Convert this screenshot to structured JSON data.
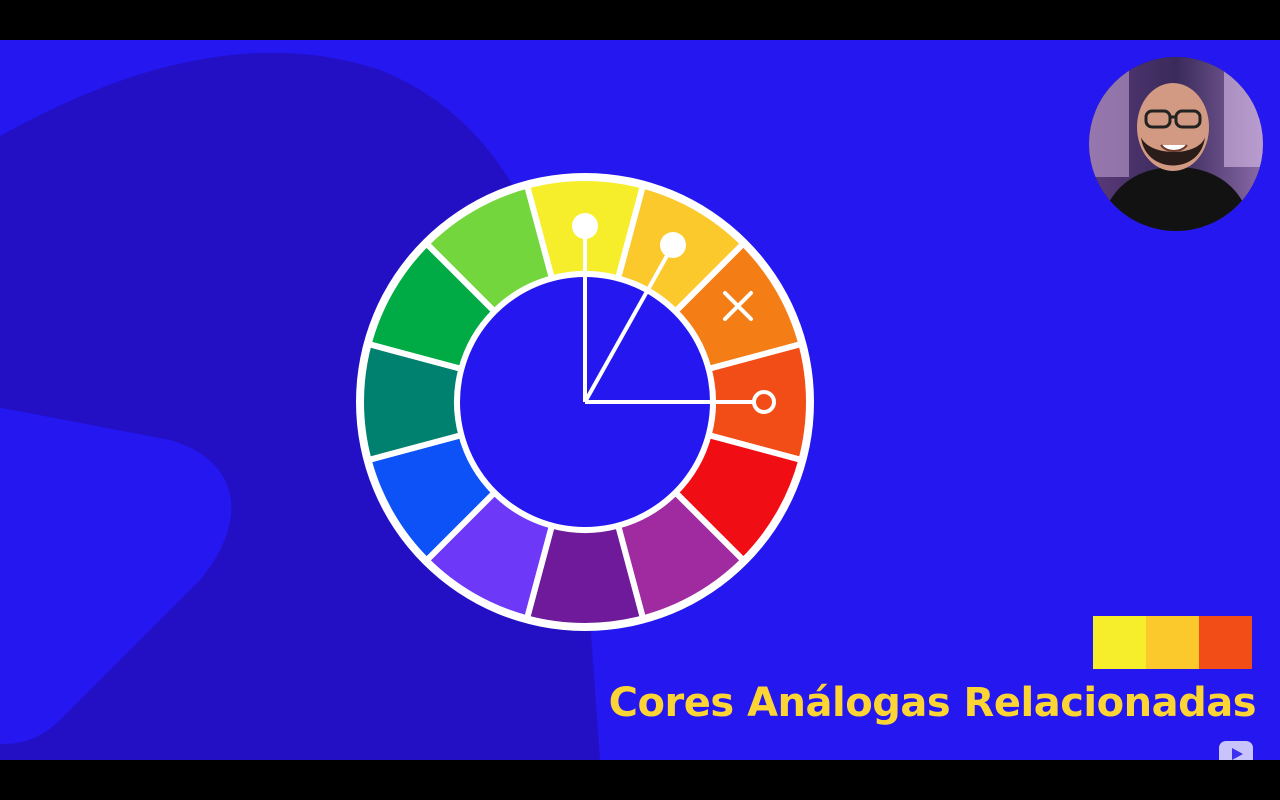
{
  "caption": {
    "text": "Cores Análogas Relacionadas",
    "color": "#fcd534"
  },
  "background": {
    "main": "#2417ef",
    "shape": "#2310c4",
    "letterbox": "#000000"
  },
  "color_wheel": {
    "segments": [
      "#f7ee2b",
      "#fbc92b",
      "#f57d16",
      "#f24d16",
      "#f00d14",
      "#a02ba0",
      "#6e1a9a",
      "#6d38f7",
      "#0c52f7",
      "#00806e",
      "#00aa45",
      "#72d63c"
    ],
    "selected_markers": [
      "circle",
      "circle",
      "cross",
      "ring"
    ],
    "separator_color": "#ffffff"
  },
  "swatches": [
    "#f7ee2b",
    "#fbc92b",
    "#f24d16"
  ],
  "icons": {
    "watermark": "youtube-play-icon"
  }
}
